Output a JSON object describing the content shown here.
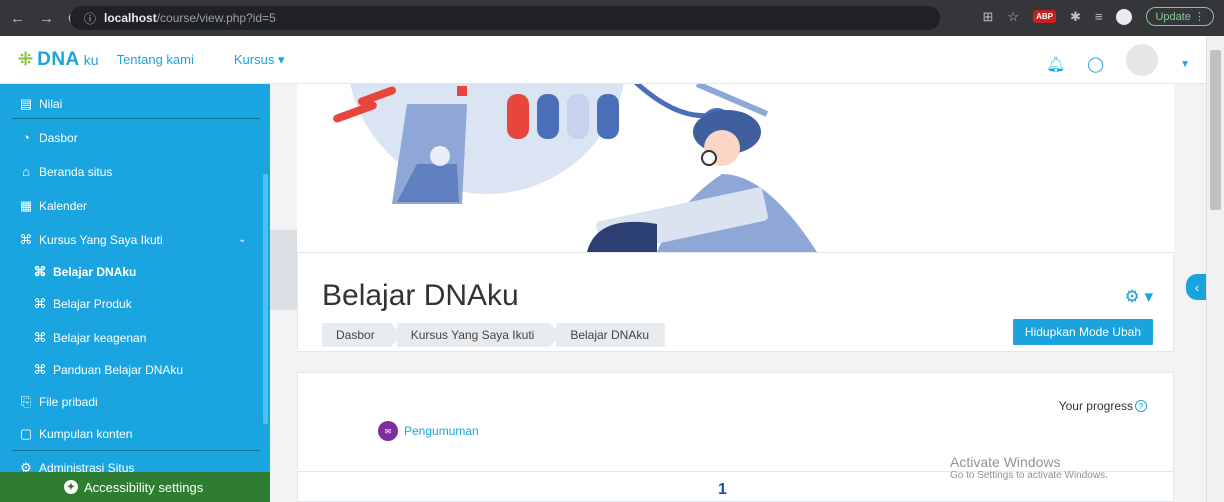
{
  "browser": {
    "url_host": "localhost",
    "url_path": "/course/view.php?id=5",
    "update_label": "Update",
    "abp_label": "ABP"
  },
  "navbar": {
    "brand_dna": "DNA",
    "brand_ku": "ku",
    "link_about": "Tentang kami",
    "link_courses": "Kursus ▾"
  },
  "sidebar": {
    "items": [
      {
        "label": "Nilai"
      },
      {
        "label": "Dasbor"
      },
      {
        "label": "Beranda situs"
      },
      {
        "label": "Kalender"
      },
      {
        "label": "Kursus Yang Saya Ikuti"
      },
      {
        "label": "Belajar DNAku"
      },
      {
        "label": "Belajar Produk"
      },
      {
        "label": "Belajar keagenan"
      },
      {
        "label": "Panduan Belajar DNAku"
      },
      {
        "label": "File pribadi"
      },
      {
        "label": "Kumpulan konten"
      },
      {
        "label": "Administrasi Situs"
      }
    ],
    "accessibility_label": "Accessibility settings"
  },
  "course": {
    "title": "Belajar DNAku",
    "breadcrumb": [
      "Dasbor",
      "Kursus Yang Saya Ikuti",
      "Belajar DNAku"
    ],
    "edit_button": "Hidupkan Mode Ubah",
    "progress_label": "Your progress",
    "announcement": "Pengumuman",
    "section_number": "1"
  },
  "watermark": {
    "line1": "Activate Windows",
    "line2": "Go to Settings to activate Windows."
  },
  "colors": {
    "primary": "#1ba5e0",
    "accessibility_bar": "#2e7d32",
    "announcement_icon": "#7b2f9e"
  }
}
